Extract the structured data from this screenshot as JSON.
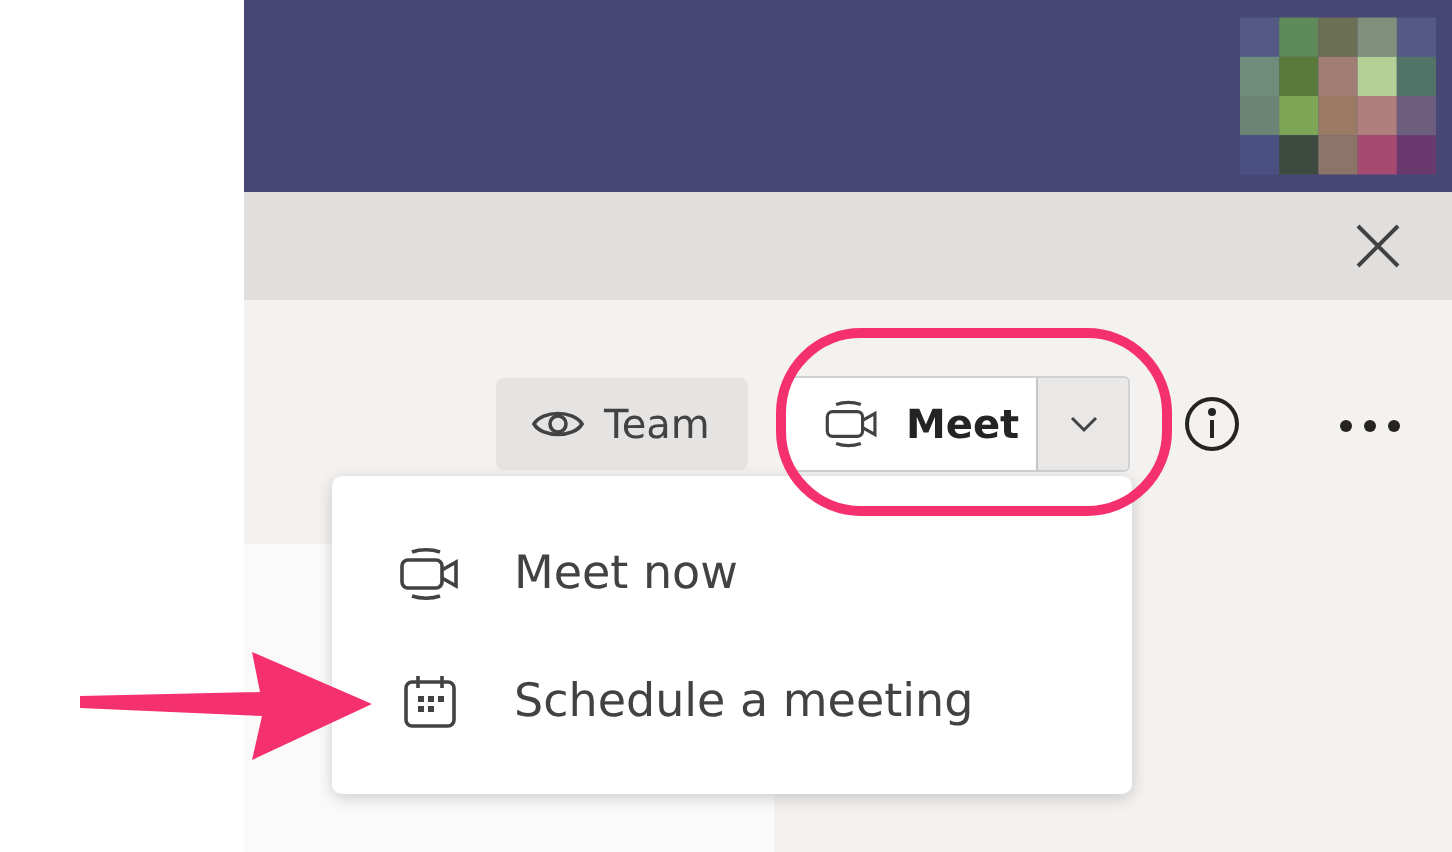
{
  "toolbar": {
    "view_button": {
      "label": "Team"
    },
    "meet_button": {
      "label": "Meet",
      "expanded": true
    }
  },
  "menu": {
    "items": [
      {
        "label": "Meet now",
        "kind": "video"
      },
      {
        "label": "Schedule a meeting",
        "kind": "calendar"
      }
    ]
  }
}
